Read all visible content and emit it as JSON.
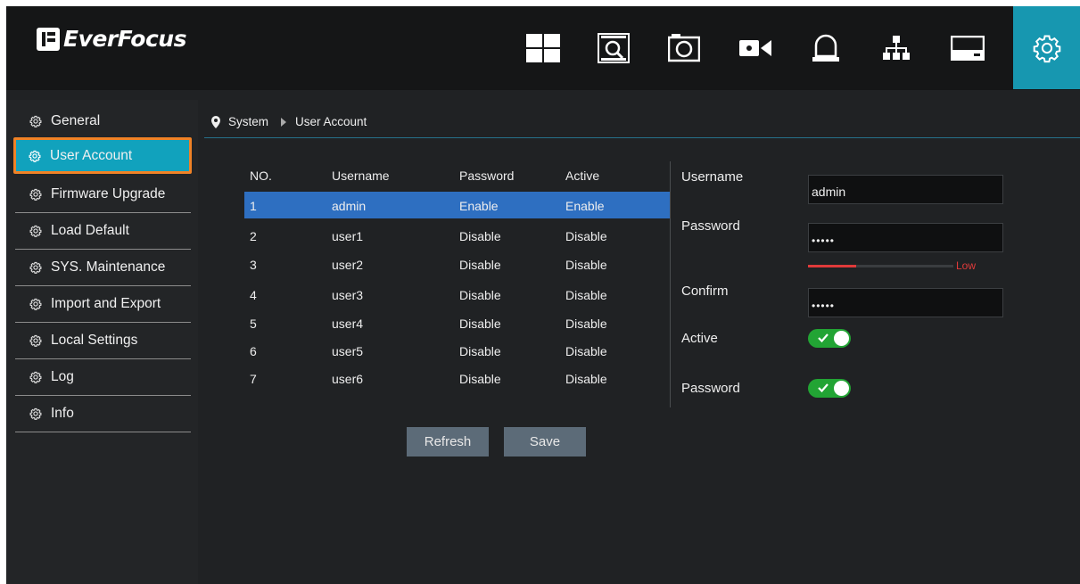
{
  "brand": {
    "name": "EverFocus"
  },
  "topbar": {
    "icons": [
      {
        "name": "live-view-icon"
      },
      {
        "name": "playback-search-icon"
      },
      {
        "name": "snapshot-icon"
      },
      {
        "name": "record-icon"
      },
      {
        "name": "alarm-icon"
      },
      {
        "name": "network-icon"
      },
      {
        "name": "storage-icon"
      },
      {
        "name": "system-settings-icon",
        "active": true
      }
    ],
    "accent": "#1797b0"
  },
  "sidebar": {
    "items": [
      {
        "label": "General"
      },
      {
        "label": "User Account",
        "active": true
      },
      {
        "label": "Firmware Upgrade"
      },
      {
        "label": "Load Default"
      },
      {
        "label": "SYS. Maintenance"
      },
      {
        "label": "Import and Export"
      },
      {
        "label": "Local Settings"
      },
      {
        "label": "Log"
      },
      {
        "label": "Info"
      }
    ],
    "highlight_color": "#11a2bd",
    "outline_color": "#f08226"
  },
  "breadcrumb": {
    "root": "System",
    "current": "User Account"
  },
  "table": {
    "headers": {
      "no": "NO.",
      "username": "Username",
      "password": "Password",
      "active": "Active"
    },
    "rows": [
      {
        "no": "1",
        "username": "admin",
        "password": "Enable",
        "active": "Enable",
        "selected": true
      },
      {
        "no": "2",
        "username": "user1",
        "password": "Disable",
        "active": "Disable"
      },
      {
        "no": "3",
        "username": "user2",
        "password": "Disable",
        "active": "Disable"
      },
      {
        "no": "4",
        "username": "user3",
        "password": "Disable",
        "active": "Disable"
      },
      {
        "no": "5",
        "username": "user4",
        "password": "Disable",
        "active": "Disable"
      },
      {
        "no": "6",
        "username": "user5",
        "password": "Disable",
        "active": "Disable"
      },
      {
        "no": "7",
        "username": "user6",
        "password": "Disable",
        "active": "Disable"
      }
    ]
  },
  "form": {
    "username_label": "Username",
    "username_value": "admin",
    "password_label": "Password",
    "password_value": "•••••",
    "strength_label": "Low",
    "strength_fraction": 0.33,
    "confirm_label": "Confirm",
    "confirm_value": "•••••",
    "active_label": "Active",
    "active_on": true,
    "password_toggle_label": "Password",
    "password_toggle_on": true
  },
  "buttons": {
    "refresh": "Refresh",
    "save": "Save"
  }
}
